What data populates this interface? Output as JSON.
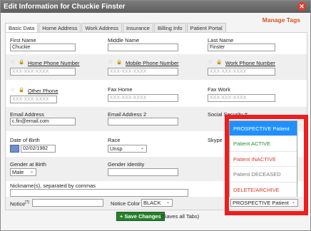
{
  "window": {
    "title": "Edit Information for Chuckie Finster",
    "close_glyph": "✕"
  },
  "manage_tags": "Manage Tags",
  "tabs": [
    "Basic Data",
    "Home Address",
    "Work Address",
    "Insurance",
    "Billing Info",
    "Patient Portal"
  ],
  "fields": {
    "first_name": {
      "label": "First Name",
      "value": "Chuckie"
    },
    "middle_name": {
      "label": "Middle Name",
      "value": ""
    },
    "last_name": {
      "label": "Last Name",
      "value": "Finster"
    },
    "home_phone": {
      "label": "Home Phone Number",
      "placeholder": "XXX-XXX-XXXX"
    },
    "mobile_phone": {
      "label": "Mobile Phone Number",
      "placeholder": "XXX-XXX-XXXX"
    },
    "work_phone": {
      "label": "Work Phone Number",
      "placeholder": "XXX-XXX-XXXX"
    },
    "other_phone": {
      "label": "Other Phone",
      "placeholder": "XXX-XXX-XXXX"
    },
    "fax_home": {
      "label": "Fax Home",
      "placeholder": "XXX-XXX-XXXX"
    },
    "fax_work": {
      "label": "Fax Work",
      "placeholder": "XXX-XXX-XXXX"
    },
    "email": {
      "label": "Email Address",
      "value": "c.fin@email.com"
    },
    "email2": {
      "label": "Email Address 2",
      "value": ""
    },
    "ssn": {
      "label": "Social Security #",
      "value": ""
    },
    "dob": {
      "label": "Date of Birth",
      "value": "02/02/1982"
    },
    "race": {
      "label": "Race",
      "value": "Unsp"
    },
    "skype": {
      "label": "Skype",
      "value": ""
    },
    "gender": {
      "label": "Gender at Birth",
      "value": "Male"
    },
    "gender_identity": {
      "label": "Gender Identity",
      "value": ""
    },
    "nicknames": {
      "label": "Nickname(s), separated by commas",
      "value": ""
    },
    "notice": {
      "label": "Notice",
      "superscript": "[?]",
      "value": ""
    },
    "notice_color": {
      "label": "Notice Color",
      "value": "BLACK"
    }
  },
  "status_menu": {
    "options": [
      {
        "label": "PROSPECTIVE Patient",
        "color": "#ffffff",
        "bg": "#1e90ff"
      },
      {
        "label": "Patient ACTIVE",
        "color": "#2e8b2e",
        "bg": "#ffffff"
      },
      {
        "label": "Patient INACTIVE",
        "color": "#d43a2a",
        "bg": "#ffffff"
      },
      {
        "label": "Patient DECEASED",
        "color": "#777777",
        "bg": "#ffffff"
      },
      {
        "label": "DELETE/ARCHIVE",
        "color": "#d43a2a",
        "bg": "#ffffff"
      }
    ],
    "selected": "PROSPECTIVE Patient"
  },
  "save_button": "+ Save Changes",
  "save_note": "(Saves all Tabs)",
  "icons": {
    "star": "☆",
    "lock": "🔒",
    "caret": "⌄",
    "calendar": "calendar-icon"
  },
  "colors": {
    "accent": "#d9531e",
    "save": "#27802c",
    "highlight": "#ee1e1e",
    "selected": "#1e90ff"
  }
}
